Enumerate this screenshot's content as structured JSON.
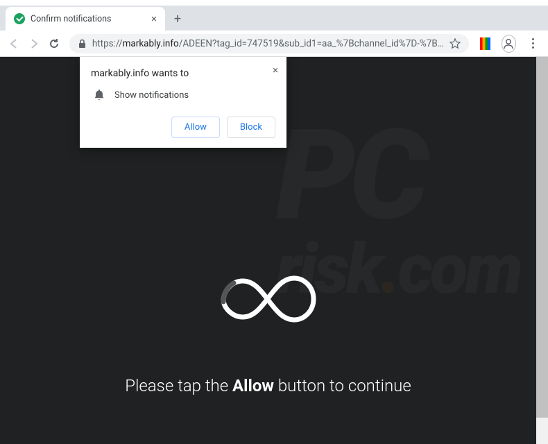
{
  "tab": {
    "title": "Confirm notifications"
  },
  "address": {
    "protocol": "https://",
    "host": "markably.info",
    "path": "/ADEEN?tag_id=747519&sub_id1=aa_%7Bchannel_id%7D-%7B…"
  },
  "permission": {
    "origin_wants_to": "markably.info wants to",
    "capability": "Show notifications",
    "allow": "Allow",
    "block": "Block"
  },
  "page": {
    "message_prefix": "Please tap the ",
    "message_bold": "Allow",
    "message_suffix": " button to continue"
  },
  "watermark": {
    "line1": "PC",
    "line2_pre": "risk",
    "line2_dot": ".",
    "line2_post": "com"
  }
}
